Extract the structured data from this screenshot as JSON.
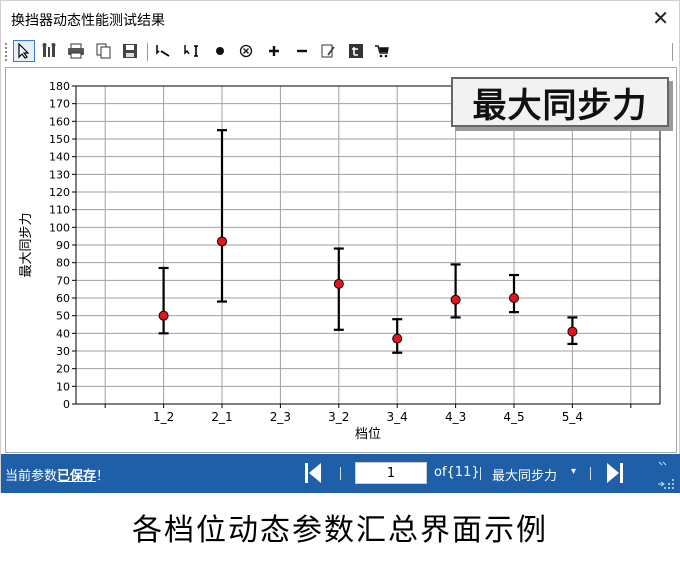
{
  "window": {
    "title": "换挡器动态性能测试结果",
    "close_glyph": "✕"
  },
  "toolbar": {
    "icons": [
      "pointer-icon",
      "properties-icon",
      "print-icon",
      "copy-icon",
      "save-icon",
      "line-tool-icon",
      "cursor-data-icon",
      "dot-icon",
      "circle-x-icon",
      "plus-icon",
      "minus-icon",
      "edit-note-icon",
      "text-tool-icon",
      "cart-icon"
    ]
  },
  "chart_data": {
    "type": "errorbar",
    "title": "最大同步力",
    "xlabel": "档位",
    "ylabel": "最大同步力",
    "categories": [
      "",
      "1_2",
      "2_1",
      "2_3",
      "3_2",
      "3_4",
      "4_3",
      "4_5",
      "5_4",
      ""
    ],
    "ylim": [
      0,
      180
    ],
    "yticks": [
      0,
      10,
      20,
      30,
      40,
      50,
      60,
      70,
      80,
      90,
      100,
      110,
      120,
      130,
      140,
      150,
      160,
      170,
      180
    ],
    "points": [
      {
        "x": "1_2",
        "mean": 50,
        "low": 40,
        "high": 77
      },
      {
        "x": "2_1",
        "mean": 92,
        "low": 58,
        "high": 155
      },
      {
        "x": "3_2",
        "mean": 68,
        "low": 42,
        "high": 88
      },
      {
        "x": "3_4",
        "mean": 37,
        "low": 29,
        "high": 48
      },
      {
        "x": "4_3",
        "mean": 59,
        "low": 49,
        "high": 79
      },
      {
        "x": "4_5",
        "mean": 60,
        "low": 52,
        "high": 73
      },
      {
        "x": "5_4",
        "mean": 41,
        "low": 34,
        "high": 49
      }
    ],
    "grid": true,
    "marker_color": "#e8141b",
    "bar_color": "#000000"
  },
  "statusbar": {
    "prefix": "当前参数",
    "saved": "已保存",
    "suffix": "！",
    "page": "1",
    "of_text": "of{11}",
    "page_name": "最大同步力",
    "dropdown_glyph": "▾",
    "background": "#1f5fa8"
  },
  "caption": "各档位动态参数汇总界面示例"
}
